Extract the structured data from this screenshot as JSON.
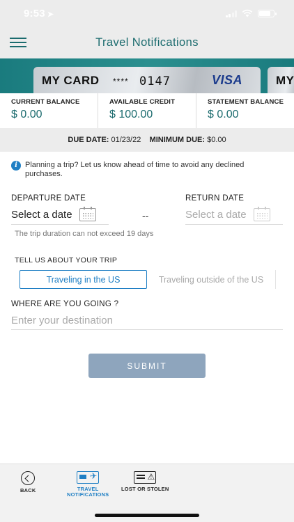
{
  "status_bar": {
    "time": "9:53"
  },
  "header": {
    "title": "Travel Notifications"
  },
  "card": {
    "name": "MY CARD",
    "mask": "****",
    "last4": "0147",
    "brand": "VISA",
    "next_card_name": "MY"
  },
  "balances": [
    {
      "label": "CURRENT BALANCE",
      "value": "$ 0.00"
    },
    {
      "label": "AVAILABLE CREDIT",
      "value": "$ 100.00"
    },
    {
      "label": "STATEMENT BALANCE",
      "value": "$ 0.00"
    }
  ],
  "due": {
    "due_label": "DUE DATE:",
    "due_value": "01/23/22",
    "min_label": "MINIMUM DUE:",
    "min_value": "$0.00"
  },
  "form": {
    "info_text": "Planning a trip? Let us know ahead of time to avoid any declined purchases.",
    "departure_label": "DEPARTURE DATE",
    "departure_placeholder": "Select a date",
    "separator": "--",
    "return_label": "RETURN DATE",
    "return_placeholder": "Select a date",
    "note": "The trip duration can not exceed 19 days",
    "trip_label": "TELL US ABOUT YOUR TRIP",
    "tab_us": "Traveling in the US",
    "tab_outside": "Traveling outside of the US",
    "destination_label": "WHERE ARE YOU GOING ?",
    "destination_placeholder": "Enter your destination",
    "destination_value": "",
    "submit_label": "SUBMIT"
  },
  "bottom_nav": {
    "back": "BACK",
    "travel_line1": "TRAVEL",
    "travel_line2": "NOTIFICATIONS",
    "lost": "LOST OR STOLEN"
  },
  "colors": {
    "accent": "#1f7fc4",
    "teal": "#1b6b6e",
    "submit_disabled": "#8ea5bd"
  }
}
